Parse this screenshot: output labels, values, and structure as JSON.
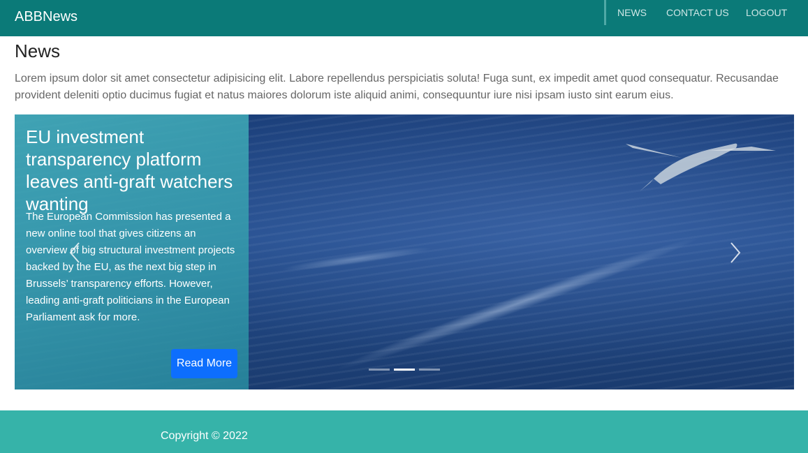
{
  "navbar": {
    "brand": "ABBNews",
    "links": [
      {
        "label": "NEWS"
      },
      {
        "label": "CONTACT US"
      },
      {
        "label": "LOGOUT"
      }
    ]
  },
  "page": {
    "title": "News",
    "intro": "Lorem ipsum dolor sit amet consectetur adipisicing elit. Labore repellendus perspiciatis soluta! Fuga sunt, ex impedit amet quod consequatur. Recusandae provident deleniti optio ducimus fugiat et natus maiores dolorum iste aliquid animi, consequuntur iure nisi ipsam iusto sint earum eius."
  },
  "carousel": {
    "slide": {
      "title": "EU investment transparency platform leaves anti-graft watchers wanting",
      "text": "The European Commission has presented a new online tool that gives citizens an overview of big structural investment projects backed by the EU, as the next big step in Brussels’ transparency efforts. However, leading anti-graft politicians in the European Parliament ask for more.",
      "button_label": "Read More"
    },
    "indicator_count": 3,
    "active_indicator": 2,
    "prev_icon": "chevron-left-icon",
    "next_icon": "chevron-right-icon"
  },
  "footer": {
    "copyright": "Copyright © 2022"
  },
  "colors": {
    "navbar": "#0b7a78",
    "footer": "#36b3a9",
    "button": "#0d6efd"
  }
}
